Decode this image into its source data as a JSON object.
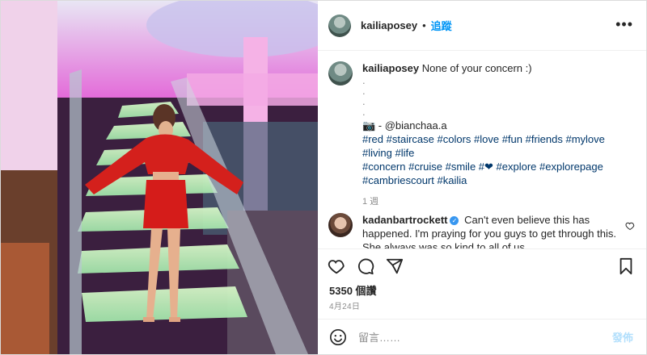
{
  "post": {
    "username": "kailiaposey",
    "follow_label": "追蹤",
    "more_label": "•••",
    "caption": {
      "text": "None of your concern :)",
      "dots": [
        ".",
        ".",
        ".",
        "."
      ],
      "photo_credit": "📷 - @bianchaa.a",
      "hashtags_line1": "#red #staircase #colors #love #fun #friends #mylove #living #life",
      "hashtags_line2_a": "#concern #cruise #smile #",
      "heart_glyph": "❤",
      "hashtags_line2_b": " #explore #explorepage",
      "hashtags_line3": "#cambriescourt #kailia",
      "time": "1 週"
    },
    "comment": {
      "username": "kadanbartrockett",
      "text": "Can't even believe this has happened. I'm praying for you guys to get through this. She always was so kind to all of us"
    },
    "likes": "5350 個讚",
    "date": "4月24日",
    "add_comment": {
      "placeholder": "留言……",
      "post_label": "發佈"
    },
    "icons": {
      "like": "heart-icon",
      "comment": "comment-icon",
      "share": "share-icon",
      "save": "bookmark-icon",
      "emoji": "emoji-icon",
      "more": "more-icon"
    },
    "colors": {
      "link": "#0095f6",
      "hashtag": "#00376b",
      "secondary": "#8e8e8e",
      "heart": "#e02a20"
    }
  }
}
